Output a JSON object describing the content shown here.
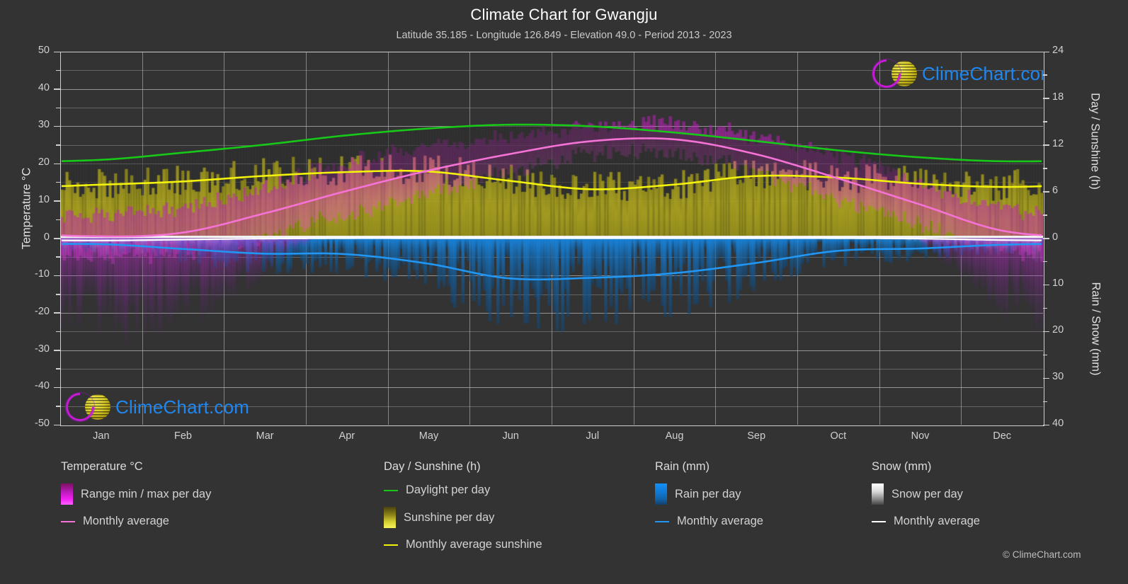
{
  "header": {
    "title": "Climate Chart for Gwangju",
    "subtitle": "Latitude 35.185 - Longitude 126.849 - Elevation 49.0 - Period 2013 - 2023"
  },
  "axes": {
    "left_title": "Temperature °C",
    "right_title_top": "Day / Sunshine (h)",
    "right_title_bottom": "Rain / Snow (mm)",
    "left_ticks": [
      "50",
      "40",
      "30",
      "20",
      "10",
      "0",
      "-10",
      "-20",
      "-30",
      "-40",
      "-50"
    ],
    "right_ticks_top": [
      "24",
      "18",
      "12",
      "6",
      "0"
    ],
    "right_ticks_bottom": [
      "10",
      "20",
      "30",
      "40"
    ],
    "x_ticks": [
      "Jan",
      "Feb",
      "Mar",
      "Apr",
      "May",
      "Jun",
      "Jul",
      "Aug",
      "Sep",
      "Oct",
      "Nov",
      "Dec"
    ]
  },
  "branding": {
    "logo_text": "ClimeChart.com",
    "copyright": "© ClimeChart.com"
  },
  "legend": {
    "temperature": {
      "heading": "Temperature °C",
      "items": [
        {
          "label": "Range min / max per day",
          "swatch": "gradient-magenta",
          "color": "#e11fe1"
        },
        {
          "label": "Monthly average",
          "swatch": "line",
          "color": "#f573d6"
        }
      ]
    },
    "day_sunshine": {
      "heading": "Day / Sunshine (h)",
      "items": [
        {
          "label": "Daylight per day",
          "swatch": "line",
          "color": "#18c818"
        },
        {
          "label": "Sunshine per day",
          "swatch": "gradient-yellow",
          "color": "#f2ee4e"
        },
        {
          "label": "Monthly average sunshine",
          "swatch": "line",
          "color": "#f2f20c"
        }
      ]
    },
    "rain": {
      "heading": "Rain (mm)",
      "items": [
        {
          "label": "Rain per day",
          "swatch": "gradient-blue",
          "color": "#1186e8"
        },
        {
          "label": "Monthly average",
          "swatch": "line",
          "color": "#2196f3"
        }
      ]
    },
    "snow": {
      "heading": "Snow (mm)",
      "items": [
        {
          "label": "Snow per day",
          "swatch": "gradient-white",
          "color": "#ffffff"
        },
        {
          "label": "Monthly average",
          "swatch": "line",
          "color": "#ffffff"
        }
      ]
    }
  },
  "chart_data": {
    "type": "line",
    "title": "Climate Chart for Gwangju",
    "subtitle": "Latitude 35.185 - Longitude 126.849 - Elevation 49.0 - Period 2013 - 2023",
    "xlabel": "",
    "ylabel": "Temperature °C",
    "ylim": [
      -50,
      50
    ],
    "y2lim_day_sunshine_h": [
      0,
      24
    ],
    "y2lim_rain_snow_mm": [
      0,
      40
    ],
    "grid": true,
    "legend_position": "below",
    "categories": [
      "Jan",
      "Feb",
      "Mar",
      "Apr",
      "May",
      "Jun",
      "Jul",
      "Aug",
      "Sep",
      "Oct",
      "Nov",
      "Dec"
    ],
    "series": [
      {
        "name": "Monthly average temperature",
        "unit": "°C",
        "axis": "left",
        "color": "#f573d6",
        "values": [
          0.5,
          1.5,
          6.5,
          12.5,
          18.0,
          22.5,
          26.0,
          26.5,
          22.5,
          16.0,
          9.0,
          2.0
        ]
      },
      {
        "name": "Daily temperature range min / max",
        "unit": "°C",
        "axis": "left",
        "color": "#e11fe1",
        "min": [
          -5.0,
          -4.0,
          0.5,
          6.0,
          12.0,
          18.0,
          22.5,
          23.0,
          18.0,
          10.0,
          3.5,
          -3.0
        ],
        "max": [
          6.5,
          8.0,
          13.5,
          20.0,
          24.5,
          27.5,
          30.0,
          31.0,
          27.5,
          22.0,
          15.0,
          8.0
        ]
      },
      {
        "name": "Daylight per day",
        "unit": "h",
        "axis": "right_top",
        "color": "#18c818",
        "values": [
          10.1,
          11.0,
          12.0,
          13.2,
          14.1,
          14.6,
          14.4,
          13.6,
          12.5,
          11.3,
          10.4,
          9.9
        ]
      },
      {
        "name": "Monthly average sunshine",
        "unit": "h",
        "axis": "right_top",
        "color": "#f2f20c",
        "values": [
          6.9,
          7.3,
          8.0,
          8.5,
          8.6,
          7.4,
          6.3,
          6.9,
          8.0,
          7.8,
          7.0,
          6.6
        ]
      },
      {
        "name": "Monthly average rain",
        "unit": "mm",
        "axis": "right_bottom",
        "color": "#2196f3",
        "values": [
          1.3,
          2.3,
          3.3,
          3.4,
          5.4,
          8.6,
          8.5,
          7.5,
          5.3,
          2.7,
          2.2,
          1.4
        ]
      },
      {
        "name": "Monthly average snow",
        "unit": "mm",
        "axis": "right_bottom",
        "color": "#ffffff",
        "values": [
          0.5,
          0.3,
          0.1,
          0.0,
          0.0,
          0.0,
          0.0,
          0.0,
          0.0,
          0.0,
          0.1,
          0.4
        ]
      }
    ]
  }
}
